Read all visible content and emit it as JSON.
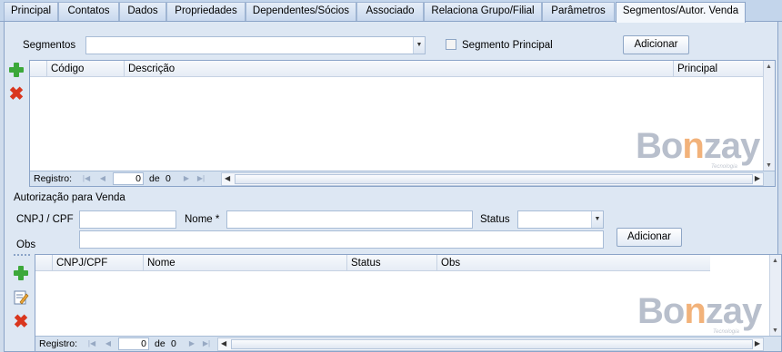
{
  "tabs": [
    {
      "label": "Principal"
    },
    {
      "label": "Contatos"
    },
    {
      "label": "Dados"
    },
    {
      "label": "Propriedades"
    },
    {
      "label": "Dependentes/Sócios"
    },
    {
      "label": "Associado"
    },
    {
      "label": "Relaciona Grupo/Filial"
    },
    {
      "label": "Parâmetros"
    },
    {
      "label": "Segmentos/Autor. Venda"
    }
  ],
  "segmentos": {
    "label": "Segmentos",
    "value": "",
    "principal_label": "Segmento Principal",
    "principal_checked": false,
    "add_label": "Adicionar",
    "grid": {
      "columns": [
        "Código",
        "Descrição",
        "Principal"
      ],
      "rows": [],
      "footer_label": "Registro:",
      "record_value": "0",
      "of_label": "de",
      "total": "0"
    }
  },
  "autorizacao": {
    "section_title": "Autorização para Venda",
    "cnpj_label": "CNPJ / CPF",
    "cnpj_value": "",
    "nome_label": "Nome *",
    "nome_value": "",
    "status_label": "Status",
    "status_value": "",
    "obs_label": "Obs",
    "obs_value": "",
    "add_label": "Adicionar",
    "grid": {
      "columns": [
        "CNPJ/CPF",
        "Nome",
        "Status",
        "Obs"
      ],
      "rows": [],
      "footer_label": "Registro:",
      "record_value": "0",
      "of_label": "de",
      "total": "0"
    }
  },
  "logo": {
    "text_a": "Bo",
    "text_n": "n",
    "text_b": "zay",
    "subtitle": "Tecnologia"
  },
  "colors": {
    "add_icon": "#3ca83a",
    "delete_icon": "#d9361e",
    "logo_accent": "#f2b27a"
  }
}
